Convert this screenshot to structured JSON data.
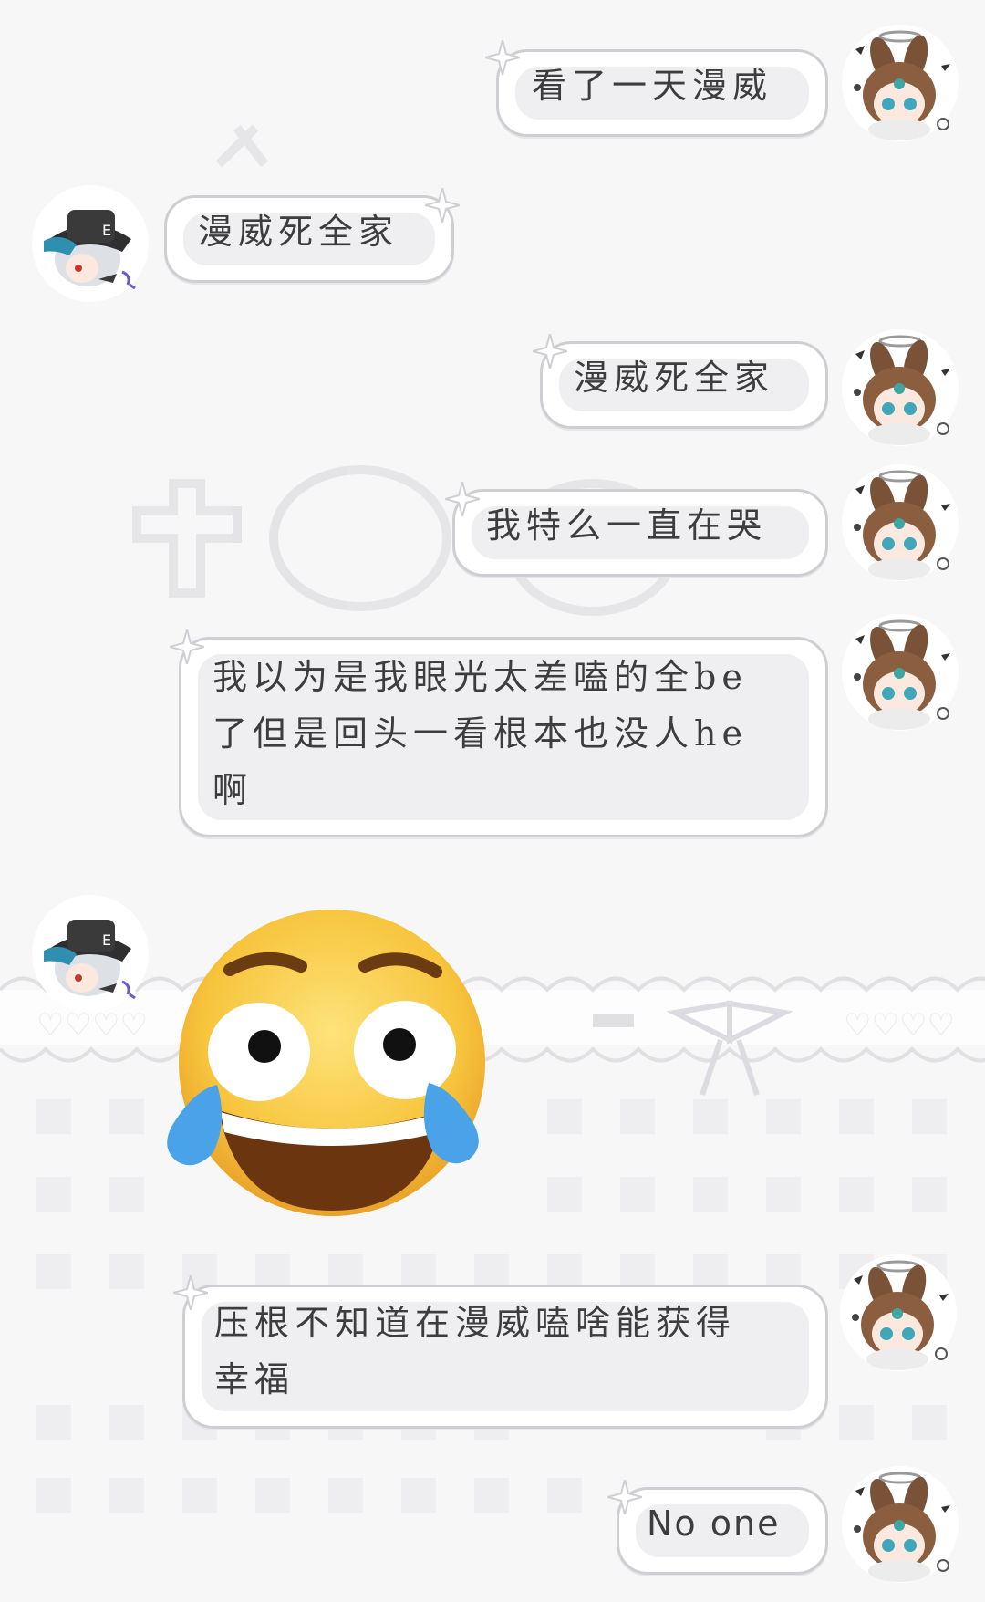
{
  "messages": [
    {
      "side": "right",
      "text": "看了一天漫威"
    },
    {
      "side": "left",
      "text": "漫威死全家"
    },
    {
      "side": "right",
      "text": "漫威死全家"
    },
    {
      "side": "right",
      "text": "我特么一直在哭"
    },
    {
      "side": "right",
      "text": "我以为是我眼光太差嗑的全be\n了但是回头一看根本也没人he\n啊"
    },
    {
      "side": "left",
      "sticker": "crying-laughing-emoji"
    },
    {
      "side": "right",
      "text": "压根不知道在漫威嗑啥能获得\n幸福"
    },
    {
      "side": "right",
      "text": "No one"
    }
  ],
  "colors": {
    "background": "#f7f7f8",
    "bubble_fill": "#efeef1",
    "bubble_border": "#cfcfd3",
    "text": "#3d3d3d",
    "emoji_yellow": "#f7c43c"
  },
  "icons": {
    "self_avatar": "brown-bunny-girl-avatar-icon",
    "other_avatar": "hat-boy-avatar-icon",
    "bubble_star": "sparkle-star-icon"
  }
}
